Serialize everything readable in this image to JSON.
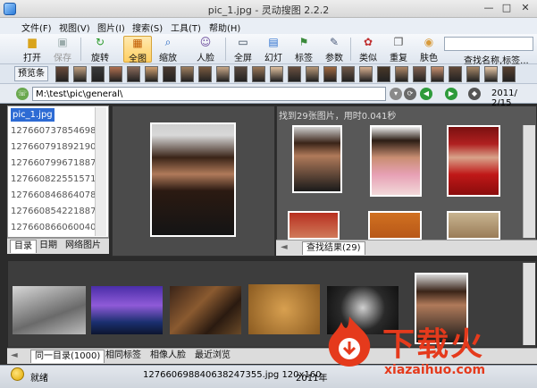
{
  "window": {
    "title": "pic_1.jpg - 灵动搜图 2.2.2"
  },
  "menu": [
    "文件(F)",
    "视图(V)",
    "图片(I)",
    "搜索(S)",
    "工具(T)",
    "帮助(H)"
  ],
  "toolbar": {
    "items": [
      {
        "label": "打开",
        "icon": "folder-open-icon"
      },
      {
        "label": "保存",
        "icon": "save-icon"
      },
      {
        "label": "旋转",
        "icon": "rotate-icon"
      },
      {
        "label": "全图",
        "icon": "fit-image-icon"
      },
      {
        "label": "缩放",
        "icon": "zoom-icon"
      },
      {
        "label": "人脸",
        "icon": "face-icon"
      },
      {
        "label": "全屏",
        "icon": "fullscreen-icon"
      },
      {
        "label": "幻灯",
        "icon": "slideshow-icon"
      },
      {
        "label": "标签",
        "icon": "tag-icon"
      },
      {
        "label": "参数",
        "icon": "wrench-icon"
      },
      {
        "label": "类似",
        "icon": "similar-icon"
      },
      {
        "label": "重复",
        "icon": "duplicate-icon"
      },
      {
        "label": "肤色",
        "icon": "skin-color-icon"
      }
    ],
    "search_placeholder": "",
    "search_link": "查找名称,标签..."
  },
  "preview": {
    "button": "预览条"
  },
  "address": {
    "path": "M:\\test\\pic\\general\\",
    "date": "2011/ 2/15"
  },
  "file_list": [
    "pic_1.jpg",
    "127660737854698",
    "127660791892190",
    "127660799671887",
    "127660822551571",
    "127660846864078",
    "127660854221887",
    "127660866060040"
  ],
  "left_tabs": [
    "目录",
    "日期",
    "网络图片"
  ],
  "results": {
    "info": "找到29张图片，用时0.041秒",
    "tab": "查找结果(29)"
  },
  "bottom_tabs": [
    "同一目录(1000)",
    "相同标签",
    "相像人脸",
    "最近浏览"
  ],
  "status": {
    "text": "就绪",
    "file": "127660698840638247355.jpg 120x160",
    "year": "2011年"
  },
  "watermark": {
    "text": "下载火",
    "url": "xiazaihuo.com"
  },
  "colors": {
    "accent": "#ffcf62",
    "brand_red": "#e53a1c",
    "panel_dark": "#4b4b4b"
  }
}
